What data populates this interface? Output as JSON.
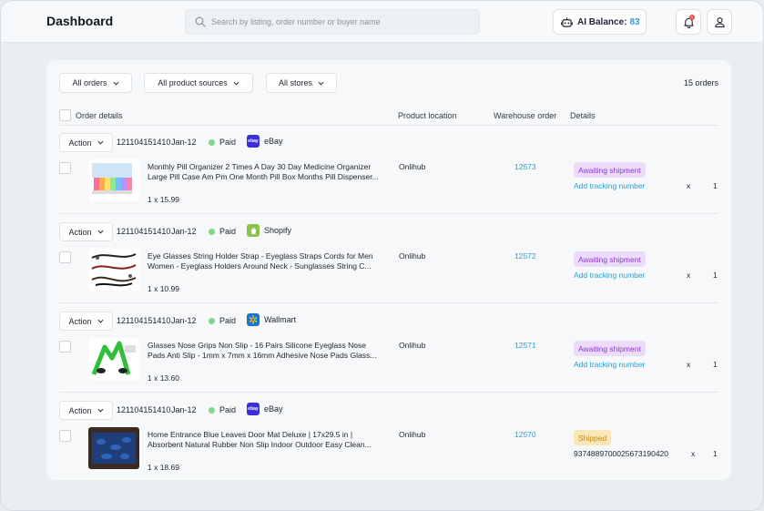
{
  "header": {
    "title": "Dashboard",
    "search_placeholder": "Search by listing, order number or buyer name",
    "ai_balance_label": "AI Balance:",
    "ai_balance_value": "83",
    "notification_count": "1"
  },
  "filters": {
    "orders": "All orders",
    "sources": "All product sources",
    "stores": "All stores",
    "count": "15 orders"
  },
  "columns": {
    "details_col": "Order details",
    "location": "Product location",
    "warehouse": "Warehouse order",
    "details": "Details"
  },
  "orders": [
    {
      "action": "Action",
      "id": "121104151410",
      "date": "Jan-12",
      "status": "Paid",
      "store": "eBay",
      "store_logo": "ebay",
      "title": "Monthly Pill Organizer 2 Times A Day 30 Day Medicine Organizer Large Pill Case Am Pm One Month Pill Box Months Pill Dispenser...",
      "qty": "1 x 15.99",
      "location": "Onlihub",
      "warehouse": "12573",
      "badge": "Awaiting shipment",
      "badge_type": "awaiting",
      "detail": "Add tracking number",
      "detail_type": "link",
      "x": "x",
      "num": "1"
    },
    {
      "action": "Action",
      "id": "121104151410",
      "date": "Jan-12",
      "status": "Paid",
      "store": "Shopify",
      "store_logo": "shopify",
      "title": "Eye Glasses String Holder Strap - Eyeglass Straps Cords for Men Women - Eyeglass Holders Around Neck - Sunglasses String C...",
      "qty": "1 x 10.99",
      "location": "Onlihub",
      "warehouse": "12572",
      "badge": "Awaiting shipment",
      "badge_type": "awaiting",
      "detail": "Add tracking number",
      "detail_type": "link",
      "x": "x",
      "num": "1"
    },
    {
      "action": "Action",
      "id": "121104151410",
      "date": "Jan-12",
      "status": "Paid",
      "store": "Wallmart",
      "store_logo": "walmart",
      "title": "Glasses Nose Grips Non Slip - 16 Pairs Silicone Eyeglass Nose Pads Anti Slip - 1mm x 7mm x 16mm Adhesive Nose Pads Glass...",
      "qty": "1 x 13.60",
      "location": "Onlihub",
      "warehouse": "12571",
      "badge": "Awaiting shipment",
      "badge_type": "awaiting",
      "detail": "Add tracking number",
      "detail_type": "link",
      "x": "x",
      "num": "1"
    },
    {
      "action": "Action",
      "id": "121104151410",
      "date": "Jan-12",
      "status": "Paid",
      "store": "eBay",
      "store_logo": "ebay",
      "title": "Home Entrance Blue Leaves Door Mat Deluxe | 17x29.5 in | Absorbent Natural Rubber Non Slip Indoor Outdoor Easy Clean...",
      "qty": "1 x 18.69",
      "location": "Onlihub",
      "warehouse": "12570",
      "badge": "Shipped",
      "badge_type": "shipped",
      "detail": "9374889700025673190420",
      "detail_type": "track",
      "x": "x",
      "num": "1"
    }
  ],
  "colors": {
    "accent": "#2a9fd6",
    "awaiting_bg": "#ecdcfa",
    "awaiting_text": "#8b3bd6",
    "shipped_bg": "#fbe6b8",
    "shipped_text": "#c58a10",
    "paid_dot": "#7dd98a"
  },
  "icons": {
    "search": "search-icon",
    "robot": "robot-icon",
    "bell": "bell-icon",
    "user": "user-icon",
    "chevron": "chevron-down-icon"
  }
}
